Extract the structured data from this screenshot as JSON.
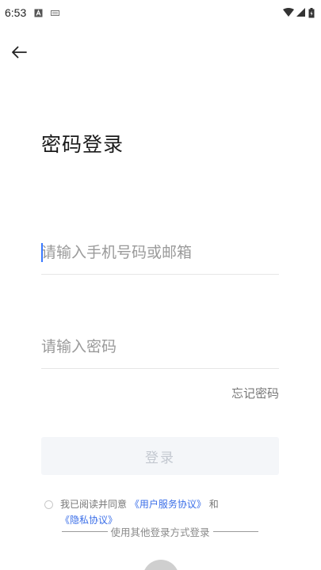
{
  "status_bar": {
    "time": "6:53"
  },
  "header": {
    "title": "密码登录"
  },
  "form": {
    "phone_placeholder": "请输入手机号码或邮箱",
    "password_placeholder": "请输入密码",
    "forgot_label": "忘记密码",
    "login_label": "登录"
  },
  "agreement": {
    "prefix": "我已阅读并同意",
    "user_agreement": "《用户服务协议》",
    "conjunction": "和",
    "privacy_policy": "《隐私协议》"
  },
  "other_login": {
    "label": "使用其他登录方式登录"
  },
  "colors": {
    "accent": "#3a6ee8",
    "button_bg": "#f4f6f9",
    "button_text": "#c3c8d0"
  }
}
